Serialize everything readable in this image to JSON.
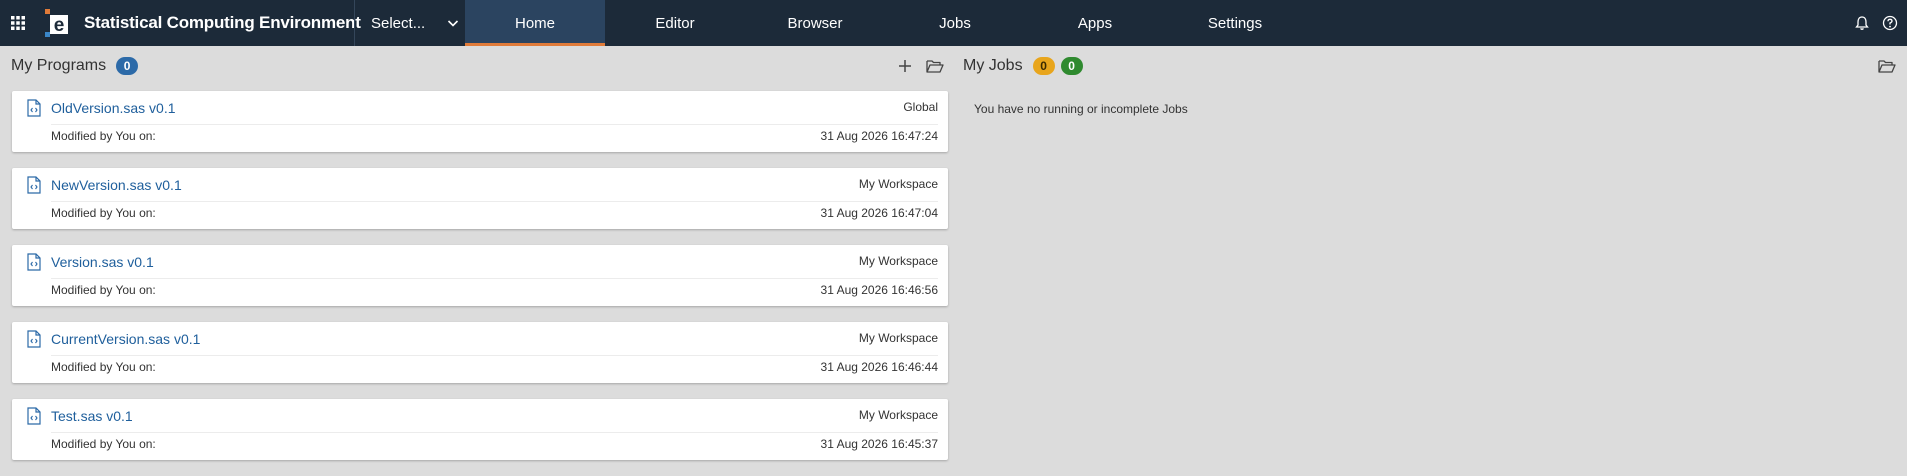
{
  "app": {
    "title": "Statistical Computing Environment"
  },
  "header": {
    "select_label": "Select...",
    "nav": [
      {
        "label": "Home",
        "active": true
      },
      {
        "label": "Editor",
        "active": false
      },
      {
        "label": "Browser",
        "active": false
      },
      {
        "label": "Jobs",
        "active": false
      },
      {
        "label": "Apps",
        "active": false
      },
      {
        "label": "Settings",
        "active": false
      }
    ]
  },
  "programs": {
    "title": "My Programs",
    "count": "0",
    "items": [
      {
        "name": "OldVersion.sas v0.1",
        "location": "Global",
        "modified_label": "Modified by You on:",
        "date": "31 Aug 2026 16:47:24"
      },
      {
        "name": "NewVersion.sas v0.1",
        "location": "My Workspace",
        "modified_label": "Modified by You on:",
        "date": "31 Aug 2026 16:47:04"
      },
      {
        "name": "Version.sas v0.1",
        "location": "My Workspace",
        "modified_label": "Modified by You on:",
        "date": "31 Aug 2026 16:46:56"
      },
      {
        "name": "CurrentVersion.sas v0.1",
        "location": "My Workspace",
        "modified_label": "Modified by You on:",
        "date": "31 Aug 2026 16:46:44"
      },
      {
        "name": "Test.sas v0.1",
        "location": "My Workspace",
        "modified_label": "Modified by You on:",
        "date": "31 Aug 2026 16:45:37"
      }
    ]
  },
  "jobs": {
    "title": "My Jobs",
    "running_count": "0",
    "complete_count": "0",
    "empty_message": "You have no running or incomplete Jobs"
  },
  "colors": {
    "topbar": "#1c2a39",
    "active_tab": "#2b4460",
    "active_underline": "#e07b39",
    "link": "#1f5f9c",
    "badge_blue": "#2c6aa8",
    "badge_orange": "#e8a51c",
    "badge_green": "#2f8a2f"
  }
}
